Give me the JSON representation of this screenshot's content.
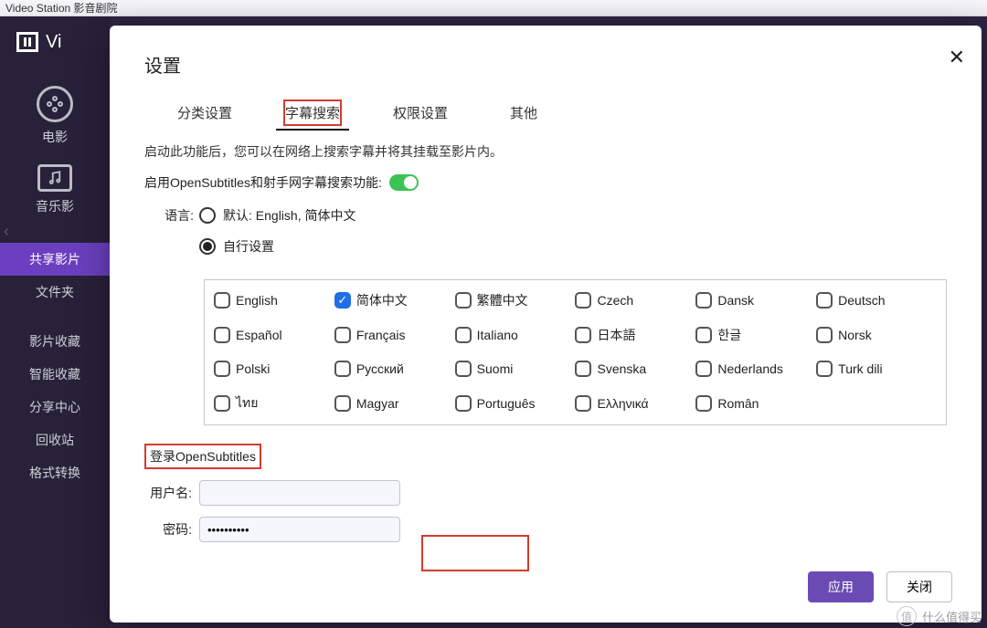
{
  "window": {
    "title": "Video Station 影音剧院"
  },
  "sidebar": {
    "app_name_short": "Vi",
    "groups": [
      {
        "label": "电影"
      },
      {
        "label": "音乐影"
      }
    ],
    "items": [
      {
        "label": "共享影片",
        "active": true
      },
      {
        "label": "文件夹"
      },
      {
        "label": "影片收藏"
      },
      {
        "label": "智能收藏"
      },
      {
        "label": "分享中心"
      },
      {
        "label": "回收站"
      },
      {
        "label": "格式转换"
      }
    ]
  },
  "modal": {
    "title": "设置",
    "tabs": [
      {
        "label": "分类设置"
      },
      {
        "label": "字幕搜索",
        "active": true
      },
      {
        "label": "权限设置"
      },
      {
        "label": "其他"
      }
    ],
    "description": "启动此功能后，您可以在网络上搜索字幕并将其挂载至影片内。",
    "toggle_label": "启用OpenSubtitles和射手网字幕搜索功能:",
    "toggle_on": true,
    "language_label": "语言:",
    "radios": {
      "default": {
        "label": "默认: English, 简体中文",
        "selected": false
      },
      "custom": {
        "label": "自行设置",
        "selected": true
      }
    },
    "languages": [
      {
        "label": "English",
        "checked": false
      },
      {
        "label": "简体中文",
        "checked": true
      },
      {
        "label": "繁體中文",
        "checked": false
      },
      {
        "label": "Czech",
        "checked": false
      },
      {
        "label": "Dansk",
        "checked": false
      },
      {
        "label": "Deutsch",
        "checked": false
      },
      {
        "label": "Español",
        "checked": false
      },
      {
        "label": "Français",
        "checked": false
      },
      {
        "label": "Italiano",
        "checked": false
      },
      {
        "label": "日本語",
        "checked": false
      },
      {
        "label": "한글",
        "checked": false
      },
      {
        "label": "Norsk",
        "checked": false
      },
      {
        "label": "Polski",
        "checked": false
      },
      {
        "label": "Русский",
        "checked": false
      },
      {
        "label": "Suomi",
        "checked": false
      },
      {
        "label": "Svenska",
        "checked": false
      },
      {
        "label": "Nederlands",
        "checked": false
      },
      {
        "label": "Turk dili",
        "checked": false
      },
      {
        "label": "ไทย",
        "checked": false
      },
      {
        "label": "Magyar",
        "checked": false
      },
      {
        "label": "Português",
        "checked": false
      },
      {
        "label": "Ελληνικά",
        "checked": false
      },
      {
        "label": "Român",
        "checked": false
      }
    ],
    "login_header": "登录OpenSubtitles",
    "login": {
      "username_label": "用户名:",
      "password_label": "密码:",
      "username_value": "",
      "password_value": "••••••••••"
    },
    "buttons": {
      "apply": "应用",
      "close": "关闭"
    }
  },
  "watermark": "什么值得买"
}
